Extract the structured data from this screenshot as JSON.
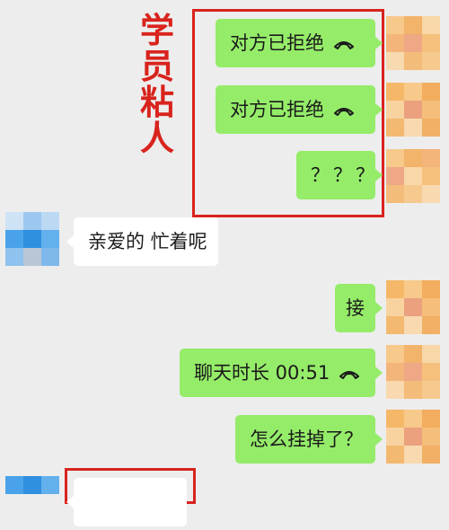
{
  "annotation": {
    "chars": [
      "学",
      "员",
      "粘",
      "人"
    ],
    "color": "#d9231d"
  },
  "messages": [
    {
      "side": "right",
      "text": "对方已拒绝",
      "icon": "hangup-phone-icon"
    },
    {
      "side": "right",
      "text": "对方已拒绝",
      "icon": "hangup-phone-icon"
    },
    {
      "side": "right",
      "text": "？？？"
    },
    {
      "side": "left",
      "text": "亲爱的 忙着呢"
    },
    {
      "side": "right",
      "text": "接"
    },
    {
      "side": "right",
      "text": "聊天时长 00:51",
      "icon": "hangup-phone-icon"
    },
    {
      "side": "right",
      "text": "怎么挂掉了？"
    }
  ],
  "colors": {
    "my_bubble": "#95ec69",
    "other_bubble": "#ffffff",
    "background": "#ededed"
  }
}
